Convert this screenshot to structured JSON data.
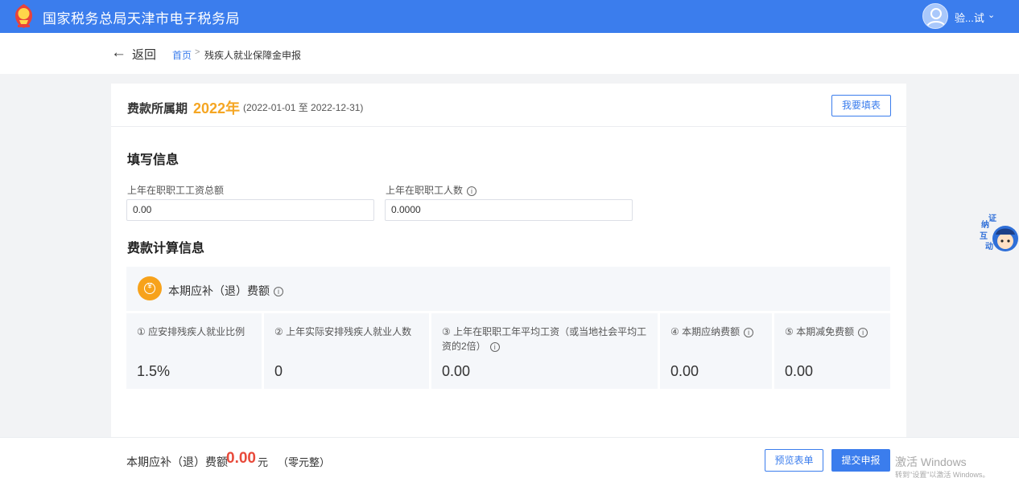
{
  "header": {
    "site_title": "国家税务总局天津市电子税务局",
    "user_name": "验...试",
    "chevron": "⌄"
  },
  "nav": {
    "back_arrow": "←",
    "back_label": "返回",
    "breadcrumb_home": "首页",
    "breadcrumb_separator": ">",
    "breadcrumb_current": "残疾人就业保障金申报"
  },
  "period": {
    "label": "费款所属期",
    "year": "2022年",
    "range": "(2022-01-01 至 2022-12-31)",
    "fill_button": "我要填表"
  },
  "fill_info": {
    "title": "填写信息",
    "fields": [
      {
        "label": "上年在职职工工资总额",
        "value": "0.00"
      },
      {
        "label": "上年在职职工人数",
        "value": "0.0000"
      }
    ]
  },
  "calc_info": {
    "title": "费款计算信息",
    "fee_title": "本期应补（退）费额",
    "yen_symbol": "¥",
    "info_glyph": "i",
    "metrics": [
      {
        "label": "① 应安排残疾人就业比例",
        "value": "1.5%"
      },
      {
        "label": "② 上年实际安排残疾人就业人数",
        "value": "0"
      },
      {
        "label_line1": "③ 上年在职职工年平均工资（或当地社会平均工",
        "label_line2": "资的2倍）",
        "value": "0.00"
      },
      {
        "label": "④ 本期应纳费额",
        "value": "0.00"
      },
      {
        "label": "⑤ 本期减免费额",
        "value": "0.00"
      }
    ]
  },
  "footer": {
    "total_label": "本期应补（退）费额",
    "total_amount": "0.00",
    "unit": "元",
    "amount_words": "（零元整）",
    "preview_button": "预览表单",
    "submit_button": "提交申报",
    "watermark_main": "激活 Windows",
    "watermark_sub": "转到\"设置\"以激活 Windows。"
  },
  "assistant": {
    "chars": [
      "纳",
      "证",
      "互",
      "动"
    ]
  },
  "colors": {
    "brand_blue": "#3b7ded",
    "accent_orange": "#f5a623",
    "amount_red": "#e84a3b",
    "panel_gray": "#f5f7fa"
  },
  "icons": {
    "emblem": "tax-emblem-icon",
    "avatar": "user-avatar-icon",
    "yen": "yen-coin-icon",
    "info": "info-circle-icon",
    "assistant": "tax-assistant-mascot-icon"
  }
}
